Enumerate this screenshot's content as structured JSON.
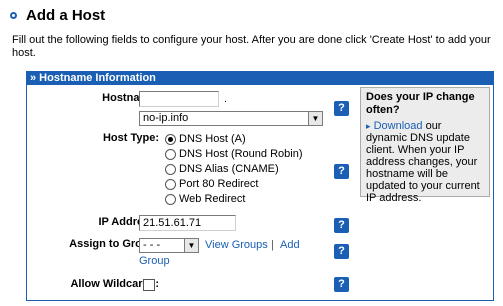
{
  "page": {
    "title": "Add a Host",
    "intro": "Fill out the following fields to configure your host. After you are done click 'Create Host' to add your host."
  },
  "panel": {
    "header": "» Hostname Information"
  },
  "form": {
    "hostname_label": "Hostname:",
    "hostname_value": "",
    "hostname_dot": ".",
    "domain_selected": "no-ip.info",
    "host_type_label": "Host Type:",
    "host_types": [
      {
        "label": "DNS Host (A)",
        "selected": true
      },
      {
        "label": "DNS Host (Round Robin)",
        "selected": false
      },
      {
        "label": "DNS Alias (CNAME)",
        "selected": false
      },
      {
        "label": "Port 80 Redirect",
        "selected": false
      },
      {
        "label": "Web Redirect",
        "selected": false
      }
    ],
    "ip_label": "IP Address:",
    "ip_value": "21.51.61.71",
    "group_label": "Assign to Group:",
    "group_selected": "- - -",
    "view_groups": "View Groups",
    "separator": "|",
    "add_group_line1": "Add",
    "add_group_line2": "Group",
    "wildcards_label": "Allow Wildcards:",
    "help": "?"
  },
  "sidebar": {
    "title": "Does your IP change often?",
    "arrow": "▸",
    "download": "Download",
    "text": " our dynamic DNS update client. When your IP address changes, your hostname will be updated to your current IP address."
  },
  "colors": {
    "accent": "#1a5fb4"
  }
}
